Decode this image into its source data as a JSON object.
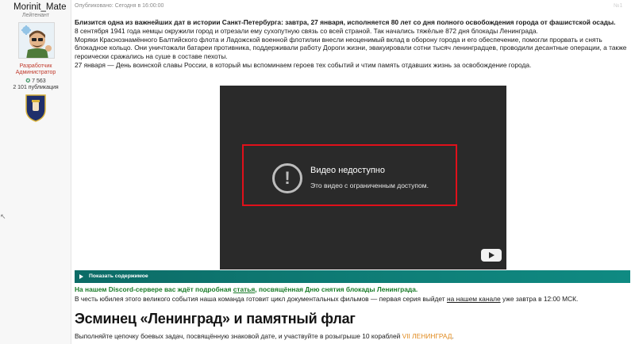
{
  "user": {
    "name": "Morinit_Mate",
    "title": "Лейтенант",
    "banner_line1": "Разработчик",
    "banner_line2": "Администратор",
    "points": "7 563",
    "posts": "2 101 публикация"
  },
  "post": {
    "published": "Опубликовано: Сегодня в 16:00:00",
    "share": "№1",
    "intro_bold": "Близится одна из важнейших дат в истории Санкт-Петербурга: завтра, 27 января, исполняется 80 лет со дня полного освобождения города от фашистской осады.",
    "para1": "8 сентября 1941 года немцы окружили город и отрезали ему сухопутную связь со всей страной. Так начались тяжёлые 872 дня блокады Ленинграда.",
    "para2": "Моряки Краснознамённого Балтийского флота и Ладожской военной флотилии внесли неоценимый вклад в оборону города и его обеспечение, помогли прорвать и снять блокадное кольцо. Они уничтожали батареи противника, поддерживали работу Дороги жизни, эвакуировали сотни тысяч ленинградцев, проводили десантные операции, а также героически сражались на суше в составе пехоты.",
    "para3": "27 января — День воинской славы России, в который мы вспоминаем героев тех событий и чтим память отдавших жизнь за освобождение города.",
    "video": {
      "title": "Видео недоступно",
      "subtitle": "Это видео с ограниченным доступом."
    },
    "spoiler_label": "Показать содержимое",
    "discord_pre": "На нашем Discord-сервере вас ждёт подробная ",
    "discord_link": "статья",
    "discord_post": ", посвящённая Дню снятия блокады Ленинграда.",
    "info_pre": "В честь юбилея этого великого события наша команда готовит цикл документальных фильмов — первая серия выйдет ",
    "info_link": "на нашем канале",
    "info_post": " уже завтра в 12:00 МСК.",
    "heading": "Эсминец «Ленинград» и памятный флаг",
    "tasks_pre": "Выполняйте цепочку боевых задач, посвящённую знаковой дате, и участвуйте в розыгрыше 10 кораблей ",
    "tasks_highlight": "VII ЛЕНИНГРАД",
    "tasks_post": "."
  },
  "icons": {
    "video_error": "exclamation-circle-icon",
    "youtube": "youtube-logo-icon",
    "spoiler": "chevron-right-icon",
    "points": "star-icon"
  },
  "colors": {
    "accent_teal": "#0f7f78",
    "discord_green": "#1b7c2a",
    "highlight_orange": "#e08a1e",
    "banner_red": "#c0392b",
    "red_frame": "#e0101a"
  }
}
